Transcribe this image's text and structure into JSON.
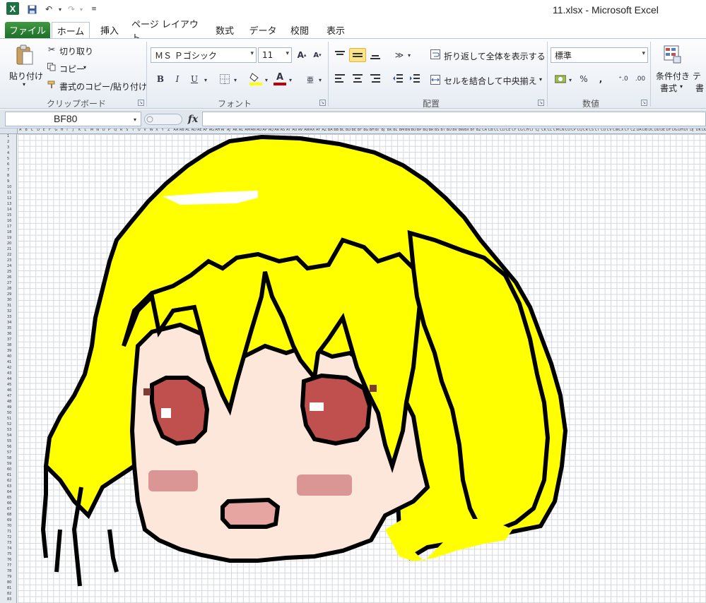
{
  "window": {
    "title": "11.xlsx - Microsoft Excel"
  },
  "quick_access": {
    "logo": "X"
  },
  "tabs": [
    "ファイル",
    "ホーム",
    "挿入",
    "ページ レイアウト",
    "数式",
    "データ",
    "校閲",
    "表示"
  ],
  "ribbon": {
    "clipboard": {
      "paste": "貼り付け",
      "cut": "切り取り",
      "copy": "コピー",
      "format_painter": "書式のコピー/貼り付け",
      "label": "クリップボード"
    },
    "font": {
      "font_name": "ＭＳ Ｐゴシック",
      "font_size": "11",
      "bold": "B",
      "italic": "I",
      "underline": "U",
      "font_color": "A",
      "label": "フォント"
    },
    "alignment": {
      "wrap_text": "折り返して全体を表示する",
      "merge_center": "セルを結合して中央揃え",
      "label": "配置"
    },
    "number": {
      "format": "標準",
      "percent": "%",
      "comma": ",",
      "label": "数値"
    },
    "styles": {
      "conditional_line1": "条件付き",
      "conditional_line2": "書式"
    }
  },
  "formula_bar": {
    "name_box": "BF80",
    "fx": "fx",
    "value": ""
  },
  "sheet": {
    "column_headers": [
      "A",
      "B",
      "C",
      "D",
      "E",
      "F",
      "G",
      "H",
      "I",
      "J",
      "K",
      "L",
      "M",
      "N",
      "O",
      "P",
      "Q",
      "R",
      "S",
      "T",
      "U",
      "V",
      "W",
      "X",
      "Y",
      "Z",
      "AA",
      "AB",
      "AC",
      "AD",
      "AE",
      "AF",
      "AG",
      "AH",
      "AI",
      "AJ",
      "AK",
      "AL",
      "AM",
      "AN",
      "AO",
      "AP",
      "AQ",
      "AR",
      "AS",
      "AT",
      "AU",
      "AV",
      "AW",
      "AX",
      "AY",
      "AZ",
      "BA",
      "BB",
      "BC",
      "BD",
      "BE",
      "BF",
      "BG",
      "BH",
      "BI",
      "BJ",
      "BK",
      "BL",
      "BM",
      "BN",
      "BO",
      "BP",
      "BQ",
      "BR",
      "BS",
      "BT",
      "BU",
      "BV",
      "BW",
      "BX",
      "BY",
      "BZ",
      "CA",
      "CB",
      "CC",
      "CD",
      "CE",
      "CF",
      "CG",
      "CH",
      "CI",
      "CJ",
      "CK",
      "CL",
      "CM",
      "CN",
      "CO",
      "CP",
      "CQ",
      "CR",
      "CS",
      "CT",
      "CU",
      "CV",
      "CW",
      "CX",
      "CY",
      "CZ",
      "DA",
      "DB",
      "DC",
      "DD",
      "DE",
      "DF",
      "DG",
      "DH",
      "DI",
      "DJ",
      "DK",
      "DL",
      "DM",
      "DN",
      "DO",
      "DP",
      "DQ"
    ],
    "row_count": 83
  },
  "colors": {
    "hair": "#ffff00",
    "outline": "#000000",
    "skin": "#fde6da",
    "eye": "#c0504d",
    "blush": "#d99694",
    "mouth": "#e6a5a0",
    "excel_green": "#1e7145"
  }
}
